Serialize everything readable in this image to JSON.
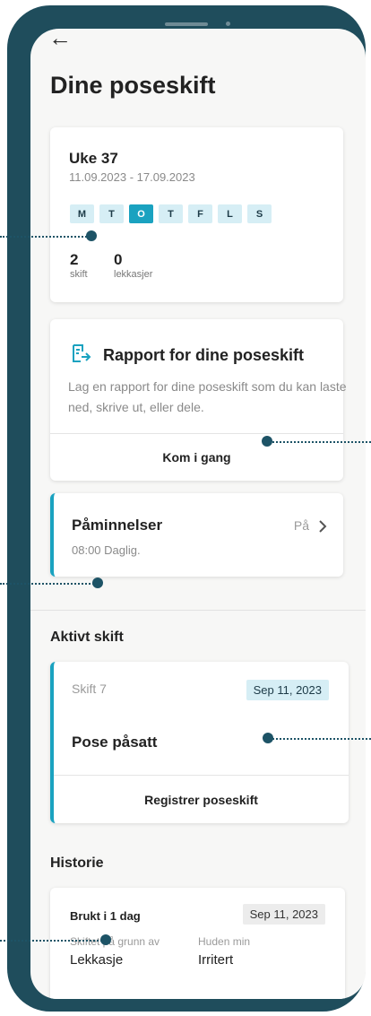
{
  "header": {
    "back_icon": "arrow-left-icon",
    "title": "Dine poseskift"
  },
  "week": {
    "title": "Uke 37",
    "range": "11.09.2023 - 17.09.2023",
    "days": [
      "M",
      "T",
      "O",
      "T",
      "F",
      "L",
      "S"
    ],
    "today_index": 2,
    "stats": [
      {
        "value": "2",
        "label": "skift"
      },
      {
        "value": "0",
        "label": "lekkasjer"
      }
    ]
  },
  "report": {
    "icon": "document-export-icon",
    "title": "Rapport for dine poseskift",
    "description": "Lag en rapport for dine poseskift som du kan laste ned, skrive ut, eller dele.",
    "cta": "Kom i gang"
  },
  "reminders": {
    "title": "Påminnelser",
    "status": "På",
    "chevron_icon": "chevron-right-icon",
    "detail": "08:00 Daglig."
  },
  "active": {
    "section_title": "Aktivt skift",
    "shift_label": "Skift 7",
    "date": "Sep 11, 2023",
    "status": "Pose påsatt",
    "cta": "Registrer poseskift"
  },
  "history": {
    "section_title": "Historie",
    "used": "Brukt i 1 dag",
    "date": "Sep 11, 2023",
    "reason_label": "Skiftet på grunn av",
    "reason_value": "Lekkasje",
    "skin_label": "Huden min",
    "skin_value": "Irritert"
  },
  "colors": {
    "accent": "#1aa2c0",
    "frame": "#1f4d5c",
    "marker": "#1d5366",
    "chip": "#d6eef5"
  }
}
